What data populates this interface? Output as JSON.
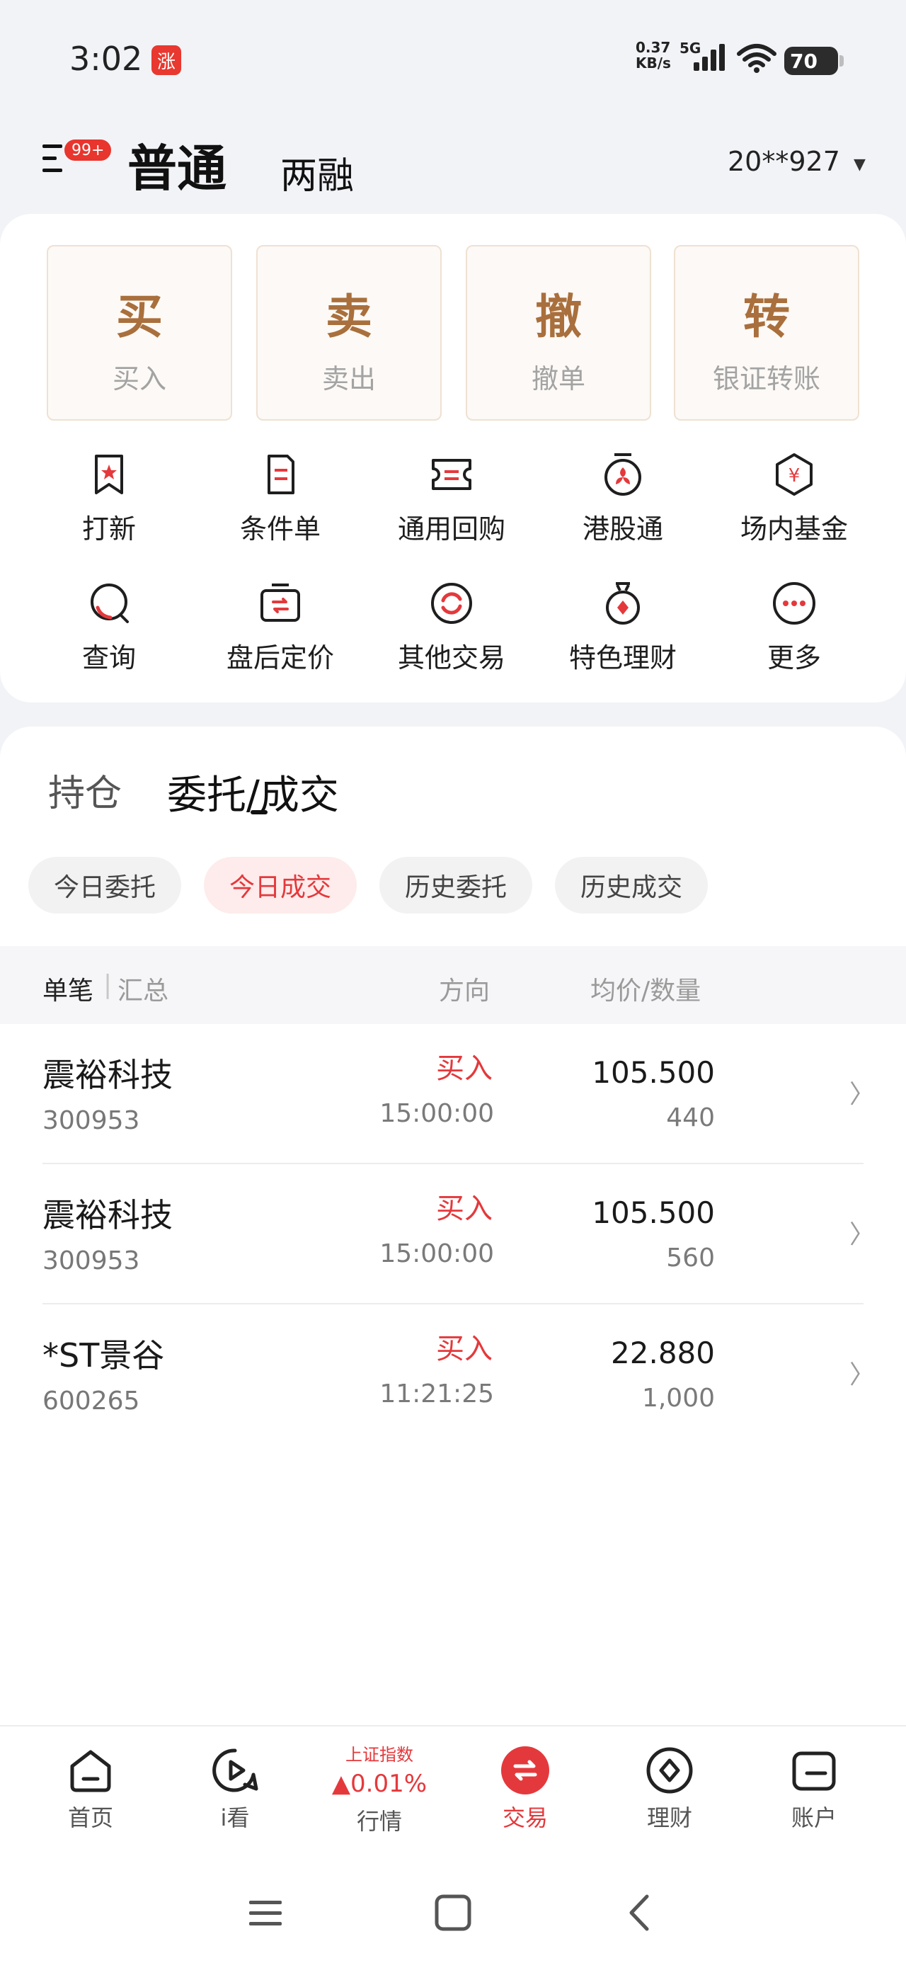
{
  "status_bar": {
    "time": "3:02",
    "app_badge": "涨",
    "net_speed": "0.37",
    "net_unit": "KB/s",
    "net_type": "5G",
    "battery": "70"
  },
  "header": {
    "menu_badge": "99+",
    "tab_normal": "普通",
    "tab_margin": "两融",
    "account": "20**927"
  },
  "big_actions": [
    {
      "char": "买",
      "label": "买入"
    },
    {
      "char": "卖",
      "label": "卖出"
    },
    {
      "char": "撤",
      "label": "撤单"
    },
    {
      "char": "转",
      "label": "银证转账"
    }
  ],
  "grid": [
    {
      "label": "打新",
      "icon": "ipo-icon"
    },
    {
      "label": "条件单",
      "icon": "condition-order-icon"
    },
    {
      "label": "通用回购",
      "icon": "repo-icon"
    },
    {
      "label": "港股通",
      "icon": "hk-connect-icon"
    },
    {
      "label": "场内基金",
      "icon": "fund-icon"
    },
    {
      "label": "查询",
      "icon": "search-icon"
    },
    {
      "label": "盘后定价",
      "icon": "after-hours-icon"
    },
    {
      "label": "其他交易",
      "icon": "other-trade-icon"
    },
    {
      "label": "特色理财",
      "icon": "wealth-icon"
    },
    {
      "label": "更多",
      "icon": "more-icon"
    }
  ],
  "segments": {
    "hold": "持仓",
    "orders": "委托/成交"
  },
  "pills": [
    "今日委托",
    "今日成交",
    "历史委托",
    "历史成交"
  ],
  "table_header": {
    "single": "单笔",
    "separator": "|",
    "summary": "汇总",
    "direction": "方向",
    "avg_qty": "均价/数量"
  },
  "rows": [
    {
      "name": "震裕科技",
      "code": "300953",
      "direction": "买入",
      "time": "15:00:00",
      "price": "105.500",
      "qty": "440"
    },
    {
      "name": "震裕科技",
      "code": "300953",
      "direction": "买入",
      "time": "15:00:00",
      "price": "105.500",
      "qty": "560"
    },
    {
      "name": "*ST景谷",
      "code": "600265",
      "direction": "买入",
      "time": "11:21:25",
      "price": "22.880",
      "qty": "1,000"
    }
  ],
  "bottom_nav": {
    "home": "首页",
    "watch": "i看",
    "market_title": "上证指数",
    "market_value": "▲0.01%",
    "market": "行情",
    "trade": "交易",
    "wealth": "理财",
    "account": "账户"
  },
  "colors": {
    "accent": "#e4393c",
    "gold": "#a96f3c",
    "background": "#f2f3f7"
  }
}
